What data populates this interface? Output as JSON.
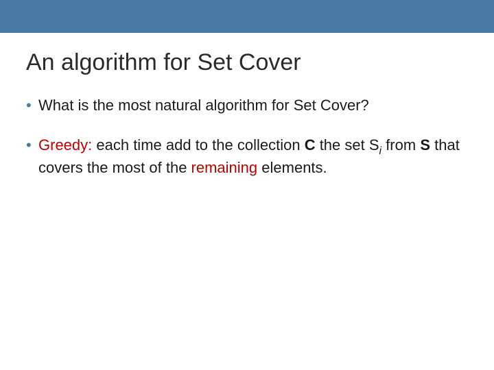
{
  "slide": {
    "title": "An algorithm for Set Cover",
    "bullet1": "What is the most natural algorithm for Set Cover?",
    "bullet2": {
      "greedy": "Greedy:",
      "t1": " each time add to the collection ",
      "C": "C",
      "t2": " the set ",
      "S": "S",
      "i": "i",
      "t3": " from ",
      "S2": "S",
      "t4": " that covers the most of the ",
      "remaining": "remaining",
      "t5": " elements."
    }
  }
}
